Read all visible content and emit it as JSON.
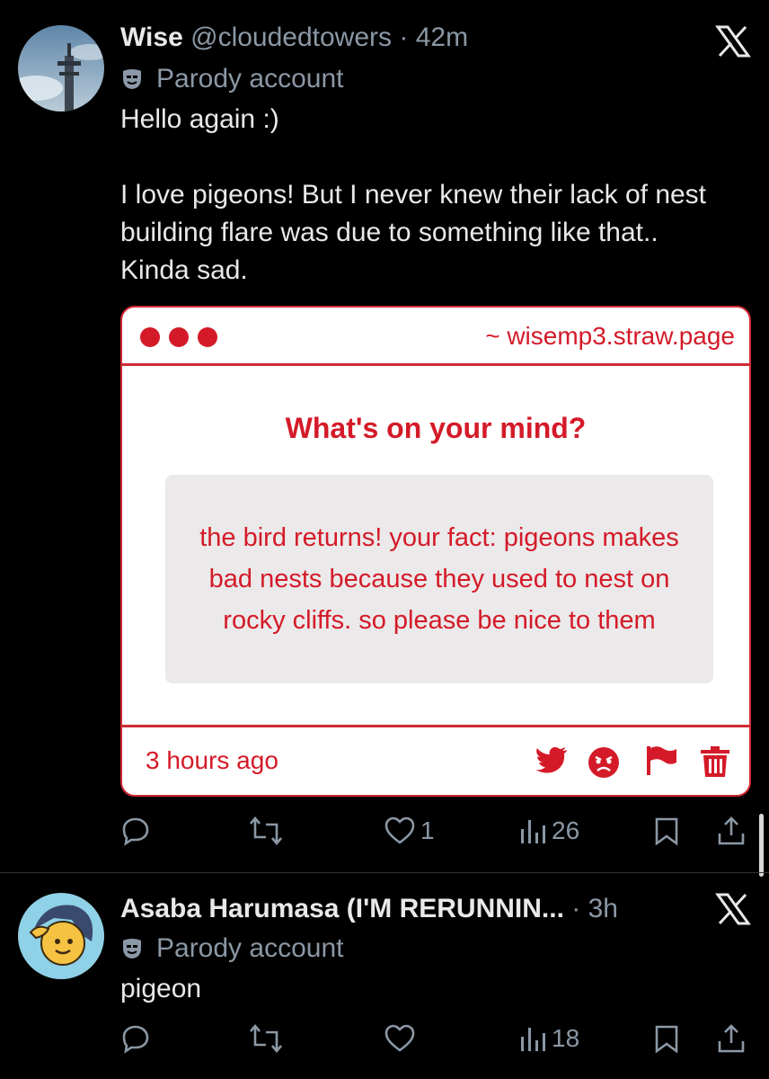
{
  "tweets": [
    {
      "name": "Wise",
      "handle": "@cloudedtowers",
      "sep": "·",
      "time": "42m",
      "parody_label": "Parody account",
      "text": "Hello again :)\n\nI love pigeons! But I never knew their lack of nest building flare was due to something like that.. Kinda sad.",
      "card": {
        "url": "~ wisemp3.straw.page",
        "question": "What's on your mind?",
        "message": "the bird returns! your fact: pigeons makes bad nests because they used to nest on rocky cliffs. so please be nice to them",
        "time_ago": "3 hours ago",
        "icons": [
          "twitter-bird-icon",
          "angry-face-icon",
          "flag-icon",
          "trash-icon"
        ]
      },
      "likes": "1",
      "views": "26"
    },
    {
      "name": "Asaba Harumasa (I'M RERUNNIN...",
      "sep": "·",
      "time": "3h",
      "parody_label": "Parody account",
      "text": "pigeon",
      "likes": "",
      "views": "18"
    }
  ],
  "colors": {
    "accent_red": "#d41a28",
    "muted": "#8b98a5",
    "text": "#e7e9ea",
    "background": "#000000"
  }
}
